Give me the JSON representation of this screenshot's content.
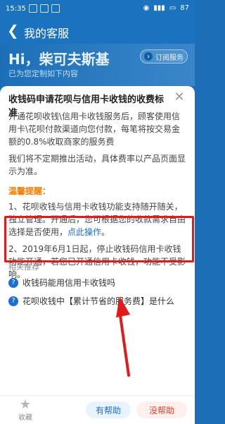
{
  "status": {
    "time": "15:35",
    "battery": "87"
  },
  "header": {
    "title": "我的客服",
    "back_icon": "chevron-left"
  },
  "hero": {
    "name": "Hi，柴可夫斯基",
    "subtitle": "已为您定制如下内容",
    "subscribe": "订阅服务"
  },
  "card": {
    "title": "收钱码申请花呗与信用卡收钱的收费标准",
    "body": "开通花呗收钱\\信用卡收钱服务后，顾客使用信用卡\\花呗付款渠道向您付款，每笔将按交易金额的0.8%收取商家的服务费",
    "body2": "我们将不定期推出活动，具体费率以产品页面显示为准。",
    "tips_title": "温馨提醒：",
    "tip1": "1、花呗收钱与信用卡收钱功能支持随开随关，独立管理。开通后，您可根据您的收款需求自由选择是否使用，",
    "tip1_link": "点此操作",
    "tip1_end": "。",
    "tip2": "2、2019年6月1日起，停止收钱码信用卡收钱功能开通，若您已开通信用卡收钱，功能不受影响。"
  },
  "related": {
    "title": "相关推荐",
    "items": [
      {
        "label": "收钱码能用信用卡收钱吗"
      },
      {
        "label": "花呗收钱中【累计节省的服务费】是什么"
      }
    ]
  },
  "bottom": {
    "collect": "收藏",
    "helpful": "有帮助",
    "not_helpful": "没帮助"
  },
  "colors": {
    "primary": "#1b73c0",
    "accent_red": "#e21a1a",
    "link_blue": "#1a6fd6",
    "tip_orange": "#ff7a00"
  }
}
